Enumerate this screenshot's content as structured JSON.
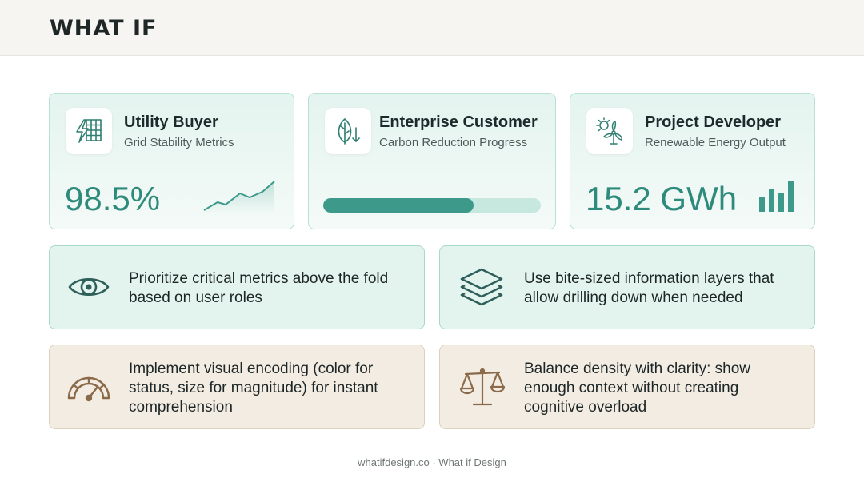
{
  "header": {
    "logo": "WHAT IF"
  },
  "roles": [
    {
      "title": "Utility Buyer",
      "subtitle": "Grid Stability Metrics",
      "metric": "98.5%",
      "icon": "grid-lightning-icon",
      "visual": "trend-line"
    },
    {
      "title": "Enterprise Customer",
      "subtitle": "Carbon Reduction Progress",
      "progress": 0.69,
      "icon": "leaf-down-arrow-icon",
      "visual": "progress-bar"
    },
    {
      "title": "Project Developer",
      "subtitle": "Renewable Energy Output",
      "metric": "15.2 GWh",
      "icon": "sun-wind-turbine-icon",
      "visual": "bar-chart"
    }
  ],
  "tips": [
    {
      "text_line1": "Prioritize critical metrics above the fold",
      "text_line2": "based on user roles",
      "icon": "eye-icon"
    },
    {
      "text_line1": "Use bite-sized information layers that",
      "text_line2": "allow drilling down when needed",
      "icon": "layers-icon"
    },
    {
      "text_line1": "Implement visual encoding (color for",
      "text_line2": "status, size for magnitude) for instant",
      "text_line3": "comprehension",
      "icon": "gauge-icon"
    },
    {
      "text_line1": "Balance density with clarity: show",
      "text_line2": "enough context without creating",
      "text_line3": "cognitive overload",
      "icon": "balance-scale-icon"
    }
  ],
  "footer": {
    "text": "whatifdesign.co · What if Design"
  },
  "colors": {
    "teal": "#3d9a8a",
    "teal_light": "#e3f3ee",
    "sand": "#f3ece3",
    "metric": "#2e8b7c",
    "icon_teal": "#2f7f73",
    "icon_brown": "#8a6a48"
  }
}
